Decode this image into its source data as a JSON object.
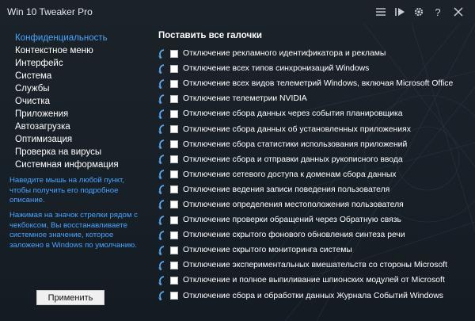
{
  "window": {
    "title": "Win 10 Tweaker Pro",
    "icons": [
      "list-icon",
      "play-step-icon",
      "gear-icon",
      "help-icon",
      "close-icon"
    ]
  },
  "sidebar": {
    "items": [
      {
        "label": "Конфиденциальность",
        "active": true
      },
      {
        "label": "Контекстное меню",
        "active": false
      },
      {
        "label": "Интерфейс",
        "active": false
      },
      {
        "label": "Система",
        "active": false
      },
      {
        "label": "Службы",
        "active": false
      },
      {
        "label": "Очистка",
        "active": false
      },
      {
        "label": "Приложения",
        "active": false
      },
      {
        "label": "Автозагрузка",
        "active": false
      },
      {
        "label": "Оптимизация",
        "active": false
      },
      {
        "label": "Проверка на вирусы",
        "active": false
      },
      {
        "label": "Системная информация",
        "active": false
      }
    ],
    "hint1": "Наведите мышь на любой пункт, чтобы получить его подробное описание.",
    "hint2": "Нажимая на значок стрелки рядом с чекбоксом, Вы восстанавливаете системное значение, которое заложено в Windows по умолчанию.",
    "apply_label": "Применить"
  },
  "main": {
    "select_all_label": "Поставить все галочки",
    "options": [
      {
        "label": "Отключение рекламного идентификатора и рекламы",
        "checked": false
      },
      {
        "label": "Отключение всех типов синхронизаций Windows",
        "checked": false
      },
      {
        "label": "Отключение всех видов телеметрий Windows, включая Microsoft Office",
        "checked": false
      },
      {
        "label": "Отключение телеметрии NVIDIA",
        "checked": false
      },
      {
        "label": "Отключение сбора данных через события планировщика",
        "checked": false
      },
      {
        "label": "Отключение сбора данных об установленных приложениях",
        "checked": false
      },
      {
        "label": "Отключение сбора статистики использования приложений",
        "checked": false
      },
      {
        "label": "Отключение сбора и отправки данных рукописного ввода",
        "checked": false
      },
      {
        "label": "Отключение сетевого доступа к доменам сбора данных",
        "checked": false
      },
      {
        "label": "Отключение ведения записи поведения пользователя",
        "checked": false
      },
      {
        "label": "Отключение определения местоположения пользователя",
        "checked": false
      },
      {
        "label": "Отключение проверки обращений через Обратную связь",
        "checked": false
      },
      {
        "label": "Отключение скрытого фонового обновления синтеза речи",
        "checked": false
      },
      {
        "label": "Отключение скрытого мониторинга системы",
        "checked": false
      },
      {
        "label": "Отключение экспериментальных вмешательств со стороны Microsoft",
        "checked": false
      },
      {
        "label": "Отключение и полное выпиливание шпионских модулей от Microsoft",
        "checked": false
      },
      {
        "label": "Отключение сбора и обработки данных Журнала Событий Windows",
        "checked": false
      }
    ]
  },
  "colors": {
    "background": "#1b2229",
    "accent": "#4aa3ff",
    "text": "#ffffff"
  }
}
